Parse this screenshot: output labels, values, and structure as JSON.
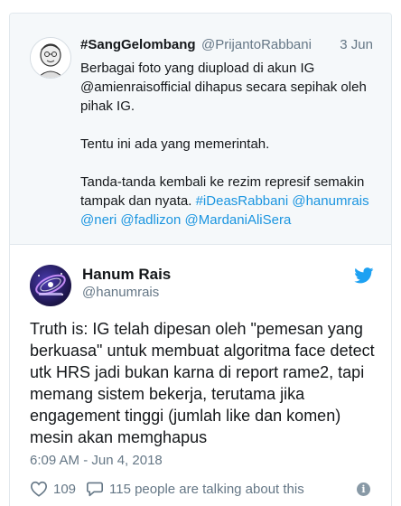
{
  "quoted_tweet": {
    "author_name": "#SangGelombang",
    "author_handle": "@PrijantoRabbani",
    "date": "3 Jun",
    "paragraph1": "Berbagai foto yang diupload di akun IG @amienraisofficial dihapus secara sepihak oleh pihak IG.",
    "paragraph2": "Tentu ini ada yang memerintah.",
    "paragraph3_text": "Tanda-tanda kembali ke rezim represif semakin tampak dan nyata.",
    "hashtag": "#iDeasRabbani",
    "mentions": [
      "@hanumrais",
      "@neri",
      "@fadlizon",
      "@MardaniAliSera"
    ]
  },
  "tweet": {
    "author_name": "Hanum Rais",
    "author_handle": "@hanumrais",
    "avatar_icon": "galaxy-avatar",
    "brand_icon": "twitter-bird-icon",
    "text": "Truth is: IG telah dipesan oleh \"pemesan yang berkuasa\" untuk membuat algoritma face detect utk HRS jadi bukan karna di report rame2, tapi memang sistem bekerja, terutama jika engagement tinggi (jumlah like dan komen) mesin akan memghapus",
    "timestamp": "6:09 AM - Jun 4, 2018",
    "like_count": "109",
    "talking_text": "115 people are talking about this",
    "info_symbol": "i"
  },
  "colors": {
    "link": "#1b95e0",
    "twitter_blue": "#1da1f2",
    "muted_text": "#657786",
    "quoted_background": "#f5f8fa"
  }
}
